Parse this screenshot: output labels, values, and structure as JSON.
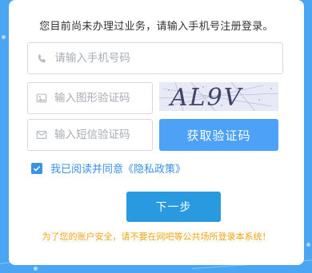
{
  "page": {
    "background": "#4aa6f3",
    "accent": "#3b91e6",
    "warning_color": "#f2a416"
  },
  "form": {
    "notice": "您目前尚未办理过业务，请输入手机号注册登录。",
    "phone": {
      "placeholder": "请输入手机号码",
      "icon": "phone-icon"
    },
    "image_code": {
      "placeholder": "输入图形验证码",
      "icon": "image-icon"
    },
    "sms_code": {
      "placeholder": "输入短信验证码",
      "icon": "message-icon"
    },
    "captcha_text": "AL9V",
    "sms_button": "获取验证码",
    "agree": {
      "checked": true,
      "text": "我已阅读并同意",
      "link": "《隐私政策》"
    },
    "next_button": "下一步",
    "warning": "为了您的账户安全，请不要在网吧等公共场所登录本系统！"
  }
}
